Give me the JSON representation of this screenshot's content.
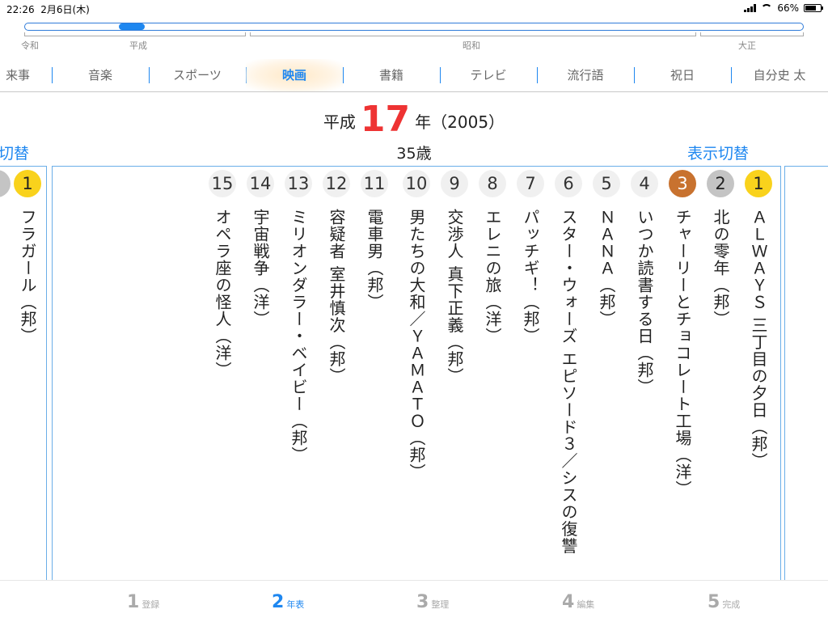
{
  "status": {
    "time": "22:26",
    "date": "2月6日(木)",
    "battery": "66%",
    "battery_level": 0.66
  },
  "eras": [
    "令和",
    "平成",
    "昭和",
    "大正"
  ],
  "tabs": [
    {
      "label": "来事",
      "active": false
    },
    {
      "label": "音楽",
      "active": false
    },
    {
      "label": "スポーツ",
      "active": false
    },
    {
      "label": "映画",
      "active": true
    },
    {
      "label": "書籍",
      "active": false
    },
    {
      "label": "テレビ",
      "active": false
    },
    {
      "label": "流行語",
      "active": false
    },
    {
      "label": "祝日",
      "active": false
    },
    {
      "label": "自分史 太",
      "active": false
    }
  ],
  "header": {
    "era": "平成",
    "year_num": "17",
    "year_suffix": "年（2005）",
    "age": "35歳",
    "toggle_label": "表示切替",
    "toggle_label_left": "切替"
  },
  "left_peek": {
    "rank": "1",
    "title": "フラガール（邦）"
  },
  "movies": [
    {
      "rank": "1",
      "title": "ＡＬＷＡＹＳ 三丁目の夕日（邦）"
    },
    {
      "rank": "2",
      "title": "北の零年（邦）"
    },
    {
      "rank": "3",
      "title": "チャーリーとチョコレート工場（洋）"
    },
    {
      "rank": "4",
      "title": "いつか読書する日（邦）"
    },
    {
      "rank": "5",
      "title": "ＮＡＮＡ（邦）"
    },
    {
      "rank": "6",
      "title": "スター・ウォーズ エピソード３／シスの復讐"
    },
    {
      "rank": "7",
      "title": "パッチギ！（邦）"
    },
    {
      "rank": "8",
      "title": "エレニの旅（洋）"
    },
    {
      "rank": "9",
      "title": "交渉人 真下正義（邦）"
    },
    {
      "rank": "10",
      "title": "男たちの大和／ＹＡＭＡＴＯ（邦）"
    },
    {
      "rank": "11",
      "title": "電車男（邦）"
    },
    {
      "rank": "12",
      "title": "容疑者 室井慎次（邦）"
    },
    {
      "rank": "13",
      "title": "ミリオンダラー・ベイビー（邦）"
    },
    {
      "rank": "14",
      "title": "宇宙戦争（洋）"
    },
    {
      "rank": "15",
      "title": "オペラ座の怪人（洋）"
    }
  ],
  "steps": [
    {
      "num": "1",
      "label": "登録",
      "active": false
    },
    {
      "num": "2",
      "label": "年表",
      "active": true
    },
    {
      "num": "3",
      "label": "整理",
      "active": false
    },
    {
      "num": "4",
      "label": "編集",
      "active": false
    },
    {
      "num": "5",
      "label": "完成",
      "active": false
    }
  ]
}
